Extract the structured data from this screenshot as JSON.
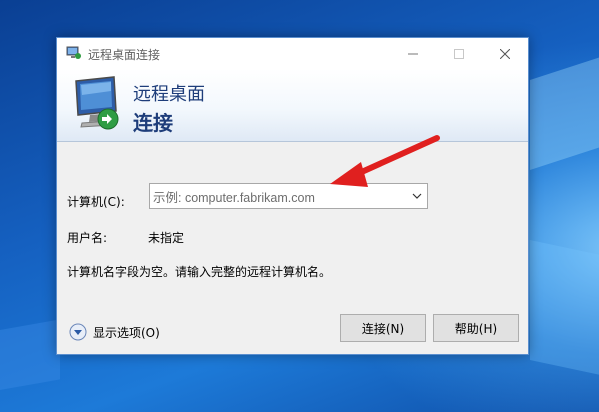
{
  "window": {
    "title": "远程桌面连接"
  },
  "banner": {
    "line1": "远程桌面",
    "line2": "连接"
  },
  "form": {
    "computer_label": "计算机(C):",
    "computer_placeholder": "示例: computer.fabrikam.com",
    "user_label": "用户名:",
    "user_value": "未指定",
    "message": "计算机名字段为空。请输入完整的远程计算机名。"
  },
  "footer": {
    "options_label": "显示选项(O)",
    "connect_label": "连接(N)",
    "help_label": "帮助(H)"
  },
  "colors": {
    "annotation_arrow": "#e0201f",
    "banner_text": "#1e3d7a"
  }
}
